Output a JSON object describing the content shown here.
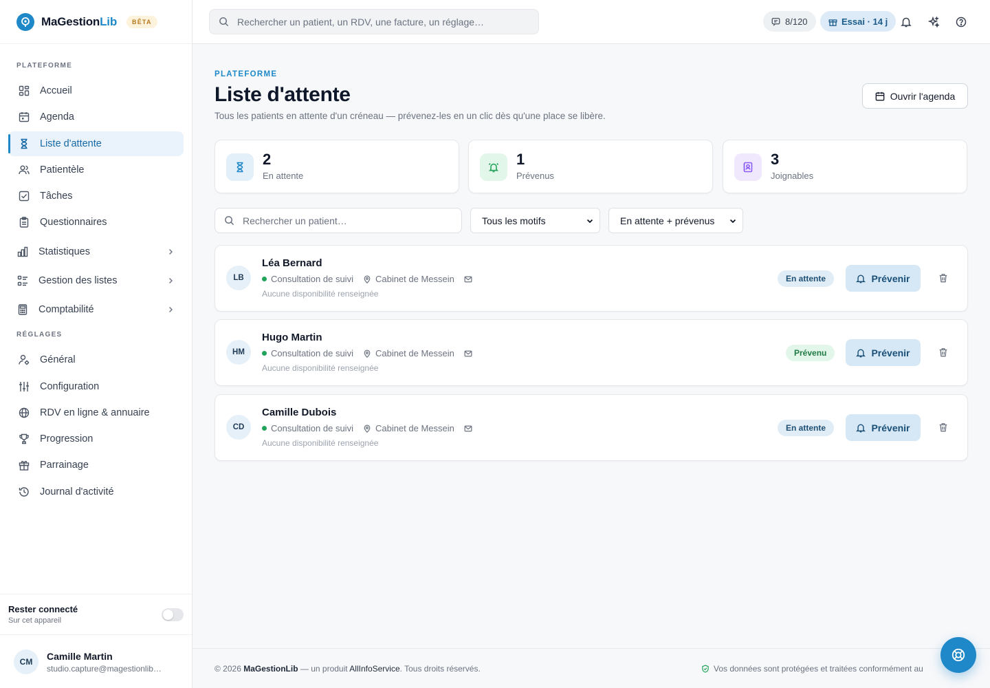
{
  "brand": {
    "name_main": "MaGestion",
    "name_accent": "Lib",
    "badge": "BÊTA"
  },
  "sidebar": {
    "section_platform": "PLATEFORME",
    "section_settings": "RÉGLAGES",
    "items": [
      {
        "label": "Accueil",
        "icon": "grid-icon"
      },
      {
        "label": "Agenda",
        "icon": "calendar-icon"
      },
      {
        "label": "Liste d'attente",
        "icon": "hourglass-icon",
        "active": true
      },
      {
        "label": "Patientèle",
        "icon": "users-icon"
      },
      {
        "label": "Tâches",
        "icon": "checkbox-icon"
      },
      {
        "label": "Questionnaires",
        "icon": "clipboard-icon"
      },
      {
        "label": "Statistiques",
        "icon": "bar-chart-icon",
        "expandable": true
      },
      {
        "label": "Gestion des listes",
        "icon": "list-icon",
        "expandable": true
      },
      {
        "label": "Comptabilité",
        "icon": "calculator-icon",
        "expandable": true
      },
      {
        "label": "Général",
        "icon": "user-gear-icon"
      },
      {
        "label": "Configuration",
        "icon": "sliders-icon"
      },
      {
        "label": "RDV en ligne & annuaire",
        "icon": "globe-icon"
      },
      {
        "label": "Progression",
        "icon": "trophy-icon"
      },
      {
        "label": "Parrainage",
        "icon": "gift-icon"
      },
      {
        "label": "Journal d'activité",
        "icon": "history-icon"
      }
    ],
    "stay_connected": {
      "title": "Rester connecté",
      "subtitle": "Sur cet appareil",
      "enabled": false
    },
    "user": {
      "initials": "CM",
      "name": "Camille Martin",
      "email": "studio.capture@magestionlib…"
    }
  },
  "topbar": {
    "search_placeholder": "Rechercher un patient, un RDV, une facture, un réglage…",
    "sms_count": "8/120",
    "trial": "Essai · 14 j"
  },
  "page": {
    "eyebrow": "PLATEFORME",
    "title": "Liste d'attente",
    "subtitle": "Tous les patients en attente d'un créneau — prévenez-les en un clic dès qu'une place se libère.",
    "open_agenda": "Ouvrir l'agenda"
  },
  "stats": [
    {
      "value": "2",
      "label": "En attente",
      "icon": "hourglass-icon",
      "color": "#1e88c8"
    },
    {
      "value": "1",
      "label": "Prévenus",
      "icon": "bell-ring-icon",
      "color": "#22a35a"
    },
    {
      "value": "3",
      "label": "Joignables",
      "icon": "contact-book-icon",
      "color": "#8b5cf6"
    }
  ],
  "filters": {
    "search_placeholder": "Rechercher un patient…",
    "motif_selected": "Tous les motifs",
    "status_selected": "En attente + prévenus"
  },
  "patients": [
    {
      "initials": "LB",
      "name": "Léa Bernard",
      "motif": "Consultation de suivi",
      "location": "Cabinet de Messein",
      "availability": "Aucune disponibilité renseignée",
      "status": "En attente",
      "status_kind": "waiting",
      "action": "Prévenir"
    },
    {
      "initials": "HM",
      "name": "Hugo Martin",
      "motif": "Consultation de suivi",
      "location": "Cabinet de Messein",
      "availability": "Aucune disponibilité renseignée",
      "status": "Prévenu",
      "status_kind": "notified",
      "action": "Prévenir"
    },
    {
      "initials": "CD",
      "name": "Camille Dubois",
      "motif": "Consultation de suivi",
      "location": "Cabinet de Messein",
      "availability": "Aucune disponibilité renseignée",
      "status": "En attente",
      "status_kind": "waiting",
      "action": "Prévenir"
    }
  ],
  "footer": {
    "prefix": "© 2026 ",
    "brand": "MaGestionLib",
    "middle": " — un produit ",
    "company": "AllInfoService",
    "suffix": ". Tous droits réservés.",
    "privacy": "Vos données sont protégées et traitées conformément au"
  },
  "colors": {
    "accent": "#1e88c8",
    "success": "#22a35a",
    "violet": "#8b5cf6"
  }
}
